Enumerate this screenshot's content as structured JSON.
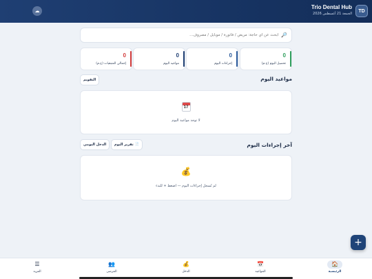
{
  "header": {
    "app_title": "Trio Dental Hub",
    "date": "الجمعة 21 أغسطس 2026",
    "avatar_initials": "TD",
    "sync_icon": "cloud-icon"
  },
  "search": {
    "placeholder": "ابحث عن أي حاجة: مريض / فاتورة / موبايل / مصروف..."
  },
  "stats": [
    {
      "value": "0",
      "label": "تحصيل اليوم (ج.م)",
      "color": "#2e9e5b"
    },
    {
      "value": "0",
      "label": "إجراءات اليوم",
      "color": "#2b5a9b"
    },
    {
      "value": "0",
      "label": "مواعيد اليوم",
      "color": "#1f3f73"
    },
    {
      "value": "0",
      "label": "إجمالي المتبقيات (ج.م)",
      "color": "#d23b3b"
    }
  ],
  "appointments": {
    "title": "مواعيد اليوم",
    "calendar_button": "التقويم",
    "empty_icon_day": "17",
    "empty_text": "لا توجد مواعيد اليوم"
  },
  "procedures": {
    "title": "آخر إجراءات اليوم",
    "report_button": "تقرير اليوم",
    "income_button": "الدخل اليومي",
    "empty_text": "لم تُسجل إجراءات اليوم — اضغط + للبدء"
  },
  "fab": {
    "label": "+"
  },
  "bottom_nav": {
    "items": [
      {
        "label": "الرئيسية",
        "icon": "home-icon",
        "glyph": "🏠"
      },
      {
        "label": "المواعيد",
        "icon": "calendar-icon",
        "glyph": "📅"
      },
      {
        "label": "الدخل",
        "icon": "money-bag-icon",
        "glyph": "💰"
      },
      {
        "label": "المرضى",
        "icon": "patients-icon",
        "glyph": "👥"
      },
      {
        "label": "المزيد",
        "icon": "menu-icon",
        "glyph": "☰"
      }
    ]
  }
}
